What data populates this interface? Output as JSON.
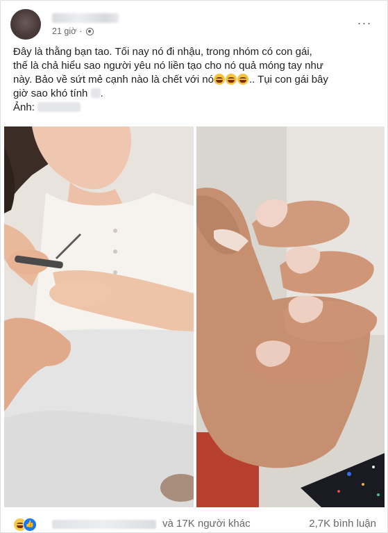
{
  "post": {
    "time": "21 giờ",
    "dot": "·",
    "more_label": "···",
    "text_lines": [
      "Đây là thằng bạn tao.  Tối nay nó đi nhậu,  trong nhóm có con gái,",
      "thế là chả hiểu sao người yêu nó liền tạo cho nó quả móng tay như",
      "này.  Bảo về sứt mẻ cạnh nào là chết với nó",
      ".. Tụi con gái bây",
      "giờ sao khó tính",
      "."
    ],
    "photo_credit_label": "Ảnh:"
  },
  "reactions": {
    "icons": [
      "haha-icon",
      "like-icon"
    ],
    "others_text": "và 17K người khác",
    "comments_text": "2,7K bình luận"
  },
  "colors": {
    "text": "#1c1e21",
    "secondary": "#65676b",
    "like_blue": "#1877f2",
    "haha_yellow": "#f7c948"
  }
}
